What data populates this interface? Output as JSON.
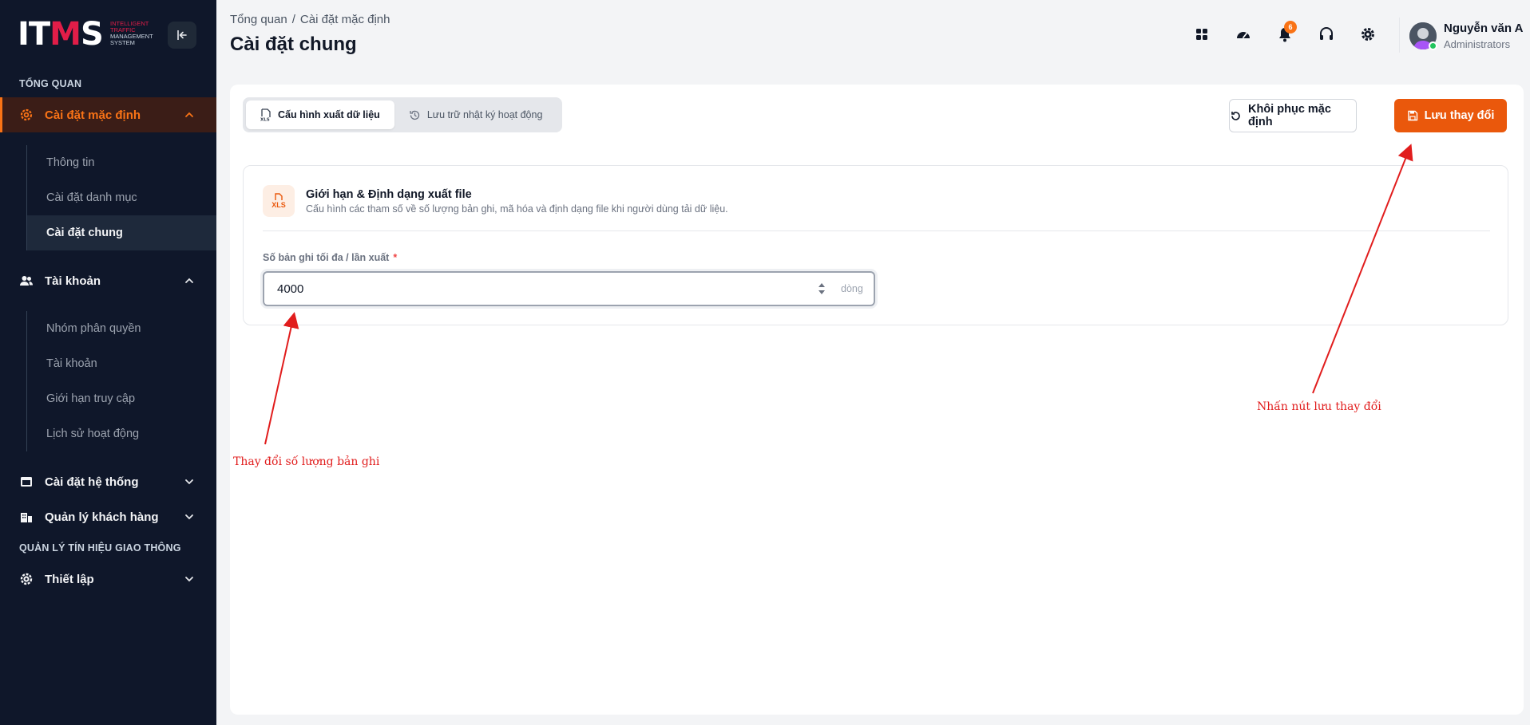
{
  "sidebar": {
    "logo": {
      "mark_left": "IT",
      "mark_m": "M",
      "mark_right": "S",
      "sub1": "Intelligent",
      "sub2": "Traffic",
      "sub3": "Management",
      "sub4": "System"
    },
    "section_overview": "TỔNG QUAN",
    "default_settings": {
      "label": "Cài đặt mặc định",
      "children": [
        "Thông tin",
        "Cài đặt danh mục",
        "Cài đặt chung"
      ]
    },
    "account": {
      "label": "Tài khoản",
      "children": [
        "Nhóm phân quyền",
        "Tài khoản",
        "Giới hạn truy cập",
        "Lịch sử hoạt động"
      ]
    },
    "system_settings": {
      "label": "Cài đặt hệ thống"
    },
    "customer_mgmt": {
      "label": "Quản lý khách hàng"
    },
    "section_traffic": "QUẢN LÝ TÍN HIỆU GIAO THÔNG",
    "setup": {
      "label": "Thiết lập"
    }
  },
  "header": {
    "breadcrumb": [
      "Tổng quan",
      "Cài đặt mặc định"
    ],
    "breadcrumb_sep": "/",
    "title": "Cài đặt chung",
    "notification_count": "6",
    "user": {
      "name": "Nguyễn văn A",
      "role": "Administrators"
    }
  },
  "main": {
    "tabs": [
      {
        "label": "Cấu hình xuất dữ liệu",
        "icon": "xls-file-icon"
      },
      {
        "label": "Lưu trữ nhật ký hoạt động",
        "icon": "history-icon"
      }
    ],
    "reset_label": "Khôi phục mặc định",
    "save_label": "Lưu thay đổi",
    "section": {
      "icon_text": "XLS",
      "title": "Giới hạn & Định dạng xuất file",
      "desc": "Cấu hình các tham số về số lượng bản ghi, mã hóa và định dạng file khi người dùng tải dữ liệu.",
      "field_label": "Số bản ghi tối đa / lần xuất",
      "required_mark": "*",
      "value": "4000",
      "unit": "dòng"
    }
  },
  "annotations": {
    "left": "Thay đổi số lượng bản ghi",
    "right": "Nhấn nút lưu thay đổi"
  },
  "colors": {
    "accent": "#ea580c",
    "sidebar_bg": "#0f172a",
    "annotation": "#e11d1d"
  }
}
